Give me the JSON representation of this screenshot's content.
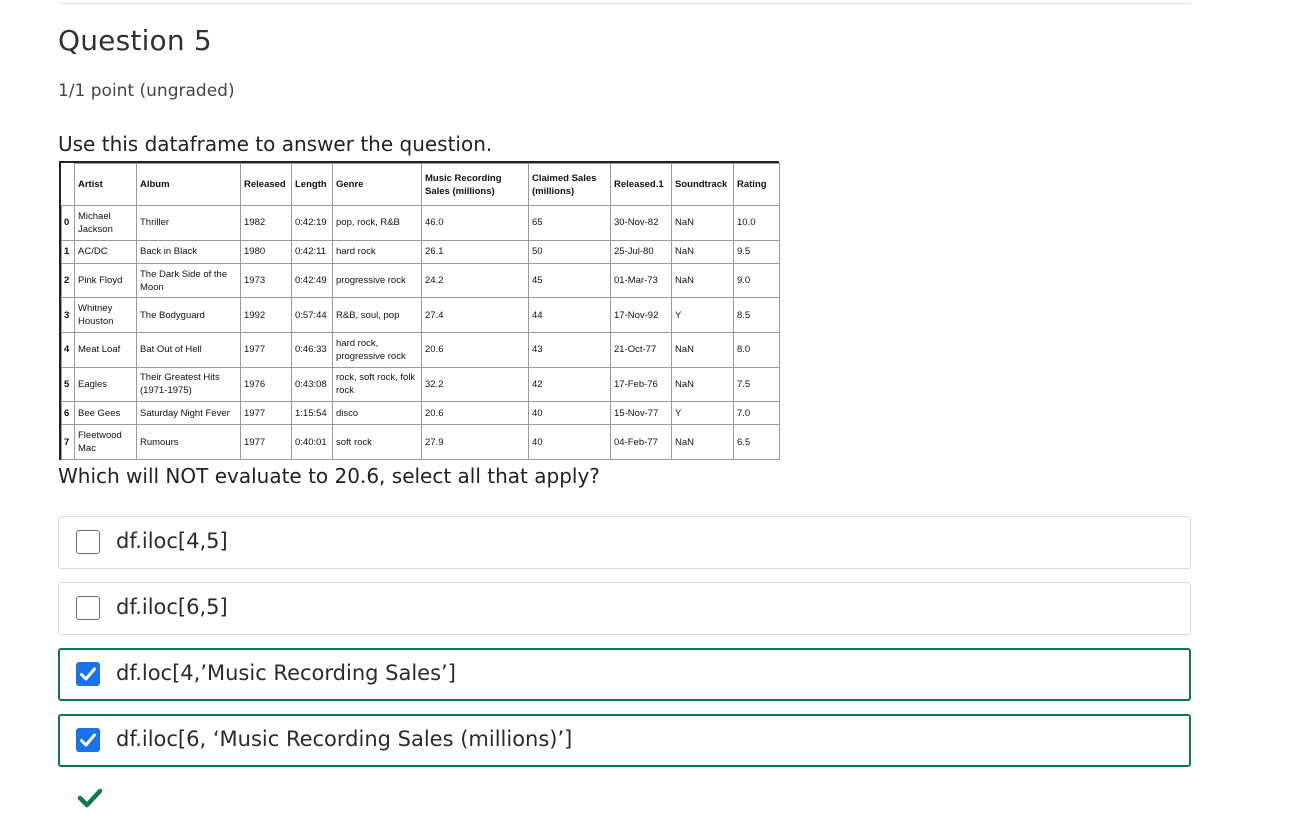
{
  "question": {
    "title": "Question 5",
    "points": "1/1 point (ungraded)",
    "intro": "Use this dataframe to answer the question.",
    "prompt": "Which will NOT evaluate to 20.6, select all that apply?"
  },
  "dataframe": {
    "columns": [
      "",
      "Artist",
      "Album",
      "Released",
      "Length",
      "Genre",
      "Music Recording Sales (millions)",
      "Claimed Sales (millions)",
      "Released.1",
      "Soundtrack",
      "Rating"
    ],
    "rows": [
      [
        "0",
        "Michael Jackson",
        "Thriller",
        "1982",
        "0:42:19",
        "pop, rock, R&B",
        "46.0",
        "65",
        "30-Nov-82",
        "NaN",
        "10.0"
      ],
      [
        "1",
        "AC/DC",
        "Back in Black",
        "1980",
        "0:42:11",
        "hard rock",
        "26.1",
        "50",
        "25-Jul-80",
        "NaN",
        "9.5"
      ],
      [
        "2",
        "Pink Floyd",
        "The Dark Side of the Moon",
        "1973",
        "0:42:49",
        "progressive rock",
        "24.2",
        "45",
        "01-Mar-73",
        "NaN",
        "9.0"
      ],
      [
        "3",
        "Whitney Houston",
        "The Bodyguard",
        "1992",
        "0:57:44",
        "R&B, soul, pop",
        "27.4",
        "44",
        "17-Nov-92",
        "Y",
        "8.5"
      ],
      [
        "4",
        "Meat Loaf",
        "Bat Out of Hell",
        "1977",
        "0:46:33",
        "hard rock, progressive rock",
        "20.6",
        "43",
        "21-Oct-77",
        "NaN",
        "8.0"
      ],
      [
        "5",
        "Eagles",
        "Their Greatest Hits (1971-1975)",
        "1976",
        "0:43:08",
        "rock, soft rock, folk rock",
        "32.2",
        "42",
        "17-Feb-76",
        "NaN",
        "7.5"
      ],
      [
        "6",
        "Bee Gees",
        "Saturday Night Fever",
        "1977",
        "1:15:54",
        "disco",
        "20.6",
        "40",
        "15-Nov-77",
        "Y",
        "7.0"
      ],
      [
        "7",
        "Fleetwood Mac",
        "Rumours",
        "1977",
        "0:40:01",
        "soft rock",
        "27.9",
        "40",
        "04-Feb-77",
        "NaN",
        "6.5"
      ]
    ]
  },
  "choices": [
    {
      "label": "df.iloc[4,5]",
      "checked": false
    },
    {
      "label": "df.iloc[6,5]",
      "checked": false
    },
    {
      "label": "df.loc[4,’Music Recording Sales’]",
      "checked": true
    },
    {
      "label": "df.iloc[6, ‘Music Recording Sales (millions)’]",
      "checked": true
    }
  ],
  "colors": {
    "accent": "#1a73e8",
    "correct": "#0d7a4a",
    "border": "#d9d9d9"
  },
  "status": {
    "icon": "checkmark-icon",
    "result": "correct"
  }
}
